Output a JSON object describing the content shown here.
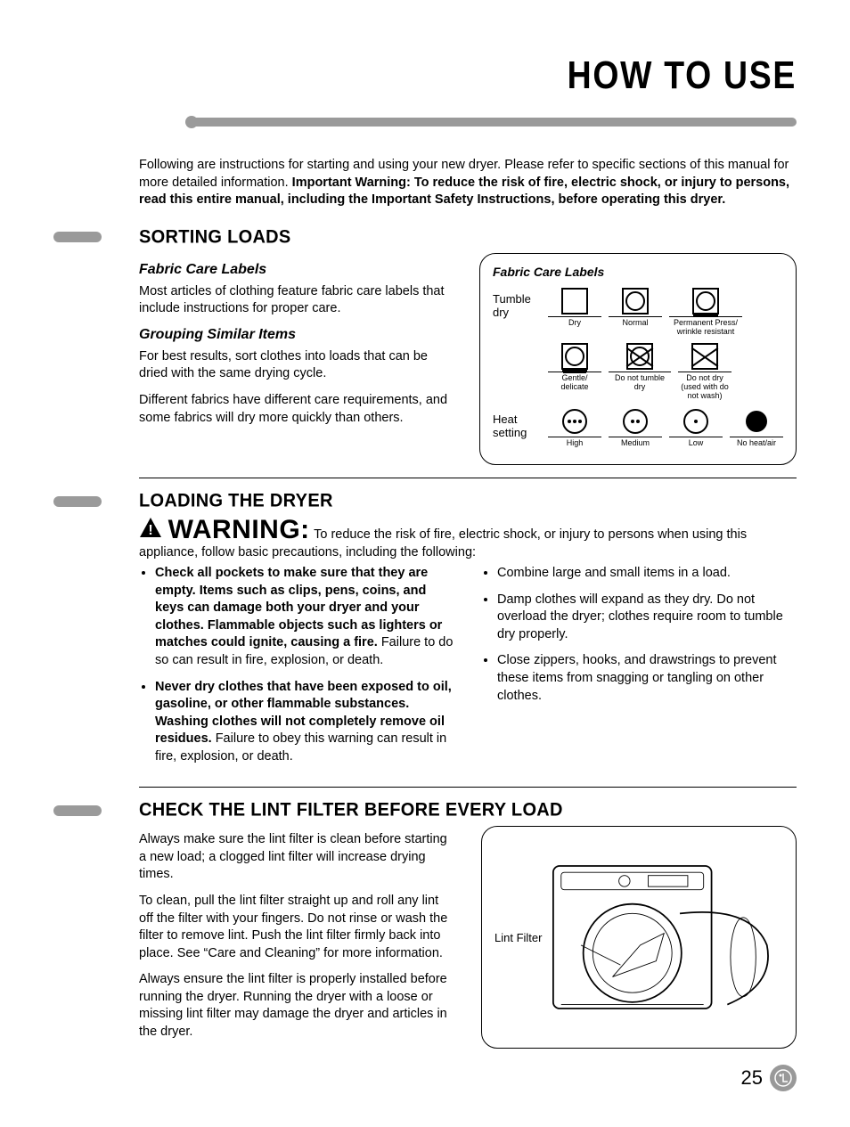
{
  "page": {
    "title": "HOW TO USE",
    "number": "25",
    "lg_badge": "LG"
  },
  "intro": {
    "lead": "Following are instructions for starting and using your new dryer. Please refer to specific sections of this manual for more detailed information. ",
    "bold": "Important Warning: To reduce the risk of fire, electric shock, or injury to persons, read this entire manual, including the Important Safety Instructions, before operating this dryer."
  },
  "section1": {
    "title": "SORTING LOADS",
    "sub1_title": "Fabric Care Labels",
    "sub1_text": "Most articles of clothing feature fabric care labels that include instructions for proper care.",
    "sub2_title": "Grouping Similar Items",
    "sub2_text1": "For best results, sort clothes into loads that can be dried with the same drying cycle.",
    "sub2_text2": "Different fabrics have different care requirements, and some fabrics will dry more quickly than others."
  },
  "care_box": {
    "title": "Fabric Care Labels",
    "row1_label": "Tumble dry",
    "row1": {
      "a": "Dry",
      "b": "Normal",
      "c": "Permanent Press/ wrinkle resistant",
      "d": "Gentle/ delicate",
      "e": "Do not tumble dry",
      "f": "Do not dry (used with do not wash)"
    },
    "row2_label": "Heat setting",
    "row2": {
      "a": "High",
      "b": "Medium",
      "c": "Low",
      "d": "No heat/air"
    }
  },
  "section2": {
    "title": "LOADING THE DRYER",
    "warn_label": "WARNING:",
    "warn_text": "To reduce the risk of fire, electric shock, or injury to persons when using this appliance, follow basic precautions, including the following:",
    "left": {
      "b1_bold": "Check all pockets to make sure that they are empty. Items such as clips, pens, coins, and keys can damage both your dryer and your clothes. Flammable objects such as lighters or matches could ignite, causing a fire.",
      "b1_tail": " Failure to do so can result in fire, explosion, or death.",
      "b2_bold": "Never dry clothes that have been exposed to oil, gasoline, or other flammable substances. Washing clothes will not completely remove oil residues.",
      "b2_tail": " Failure to obey this warning can result in fire, explosion, or death."
    },
    "right": {
      "b1": "Combine large and small items in a load.",
      "b2": "Damp clothes will expand as they dry. Do not overload the dryer; clothes require room to tumble dry properly.",
      "b3": "Close zippers, hooks, and drawstrings to prevent these items from snagging or tangling on other clothes."
    }
  },
  "section3": {
    "title": "CHECK THE LINT FILTER BEFORE EVERY LOAD",
    "p1": "Always make sure the lint filter is clean before starting a new load; a clogged lint filter will increase drying times.",
    "p2": "To clean, pull the lint filter straight up and roll any lint off the filter with your fingers. Do not rinse or wash the filter to remove lint. Push the lint filter firmly back into place. See “Care and Cleaning” for more information.",
    "p3": "Always ensure the lint filter is properly installed before running the dryer. Running the dryer with a loose or missing lint filter may damage the dryer and articles in the dryer.",
    "box_label": "Lint Filter"
  }
}
